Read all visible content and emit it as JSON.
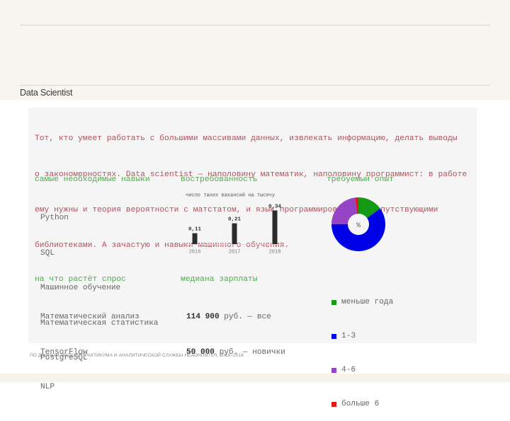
{
  "header": {
    "title": "Data Scientist"
  },
  "intro": {
    "lines": [
      "Тот, кто умеет работать с большими массивами данных, извлекать информацию, делать выводы",
      "о закономерностях. Data scientist — наполовину математик, наполовину программист: в работе",
      "ему нужны и теория вероятности с матстатом, и язык программирования с сопутствующими",
      "библиотеками. А зачастую и навыки машинного обучения."
    ]
  },
  "skills": {
    "heading": "самые необходимые навыки",
    "items": [
      "Python",
      "SQL",
      "Машинное обучение",
      "Математическая статистика",
      "PostgreSQL"
    ]
  },
  "demand": {
    "heading": "востребованность"
  },
  "experience": {
    "heading": "требуемый опыт"
  },
  "growth": {
    "heading": "на что растёт спрос",
    "items": [
      "Математический анализ",
      "TensorFlow",
      "NLP"
    ]
  },
  "salary": {
    "heading": "медиана зарплаты",
    "rows": [
      {
        "amount": "114 900",
        "rest": " руб. — все"
      },
      {
        "amount": "50 000",
        "rest": " руб. — новички"
      }
    ]
  },
  "footer": {
    "source": "ПО ДАННЫМ ЯНДЕКС.ПРАКТИКУМА И АНАЛИТИЧЕСКОЙ СЛУЖБЫ HEADHUNTER, 2016–2018"
  },
  "chart_data": [
    {
      "type": "bar",
      "title": "",
      "subtitle": "число таких вакансий на тысячу",
      "xlabel": "",
      "ylabel": "",
      "categories": [
        "2016",
        "2017",
        "2018"
      ],
      "values": [
        0.11,
        0.21,
        0.34
      ],
      "value_labels": [
        "0,11",
        "0,21",
        "0,34"
      ],
      "ylim": [
        0,
        0.35
      ],
      "grid": false,
      "bar_color": "#2b2b2b"
    },
    {
      "type": "pie",
      "donut": true,
      "title": "",
      "center_label": "%",
      "categories": [
        "меньше года",
        "1-3",
        "4-6",
        "больше 6"
      ],
      "values": [
        15,
        60,
        23,
        2
      ],
      "colors": [
        "#149a14",
        "#0000e6",
        "#9444c4",
        "#e01a1a"
      ],
      "legend": "right-below"
    }
  ]
}
